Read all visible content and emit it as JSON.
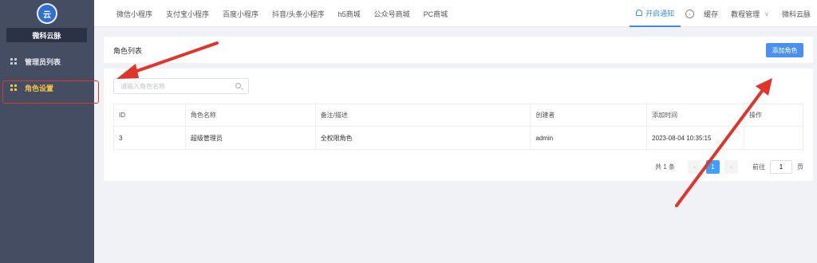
{
  "sidebar": {
    "logo_glyph": "云",
    "brand": "微科云脉",
    "items": [
      {
        "label": "管理员列表",
        "icon": "grid-icon",
        "active": false
      },
      {
        "label": "角色设置",
        "icon": "grid-icon",
        "active": true
      }
    ]
  },
  "topnav": {
    "tabs": [
      "微信小程序",
      "支付宝小程序",
      "百度小程序",
      "抖音/头条小程序",
      "h5商城",
      "公众号商城",
      "PC商城"
    ],
    "notify": "开启通知",
    "download_icon": "download-icon",
    "cache": "缓存",
    "tutorial": "教程管理",
    "user": "微科云脉"
  },
  "page": {
    "title": "角色列表",
    "add_button": "添加角色",
    "search_placeholder": "请输入角色名称"
  },
  "table": {
    "headers": [
      "ID",
      "角色名称",
      "备注/描述",
      "创建者",
      "添加时间",
      "操作"
    ],
    "rows": [
      [
        "3",
        "超级管理员",
        "全权限角色",
        "admin",
        "2023-08-04 10:35:15",
        ""
      ]
    ]
  },
  "pagination": {
    "total": "共 1 条",
    "prev": "‹",
    "current": "1",
    "next": "›",
    "goto_label": "前往",
    "goto_value": "1",
    "page_suffix": "页"
  },
  "colors": {
    "sidebar_bg": "#454d63",
    "accent": "#409eff",
    "active_menu": "#f5c244",
    "annotation": "#e0352b"
  }
}
